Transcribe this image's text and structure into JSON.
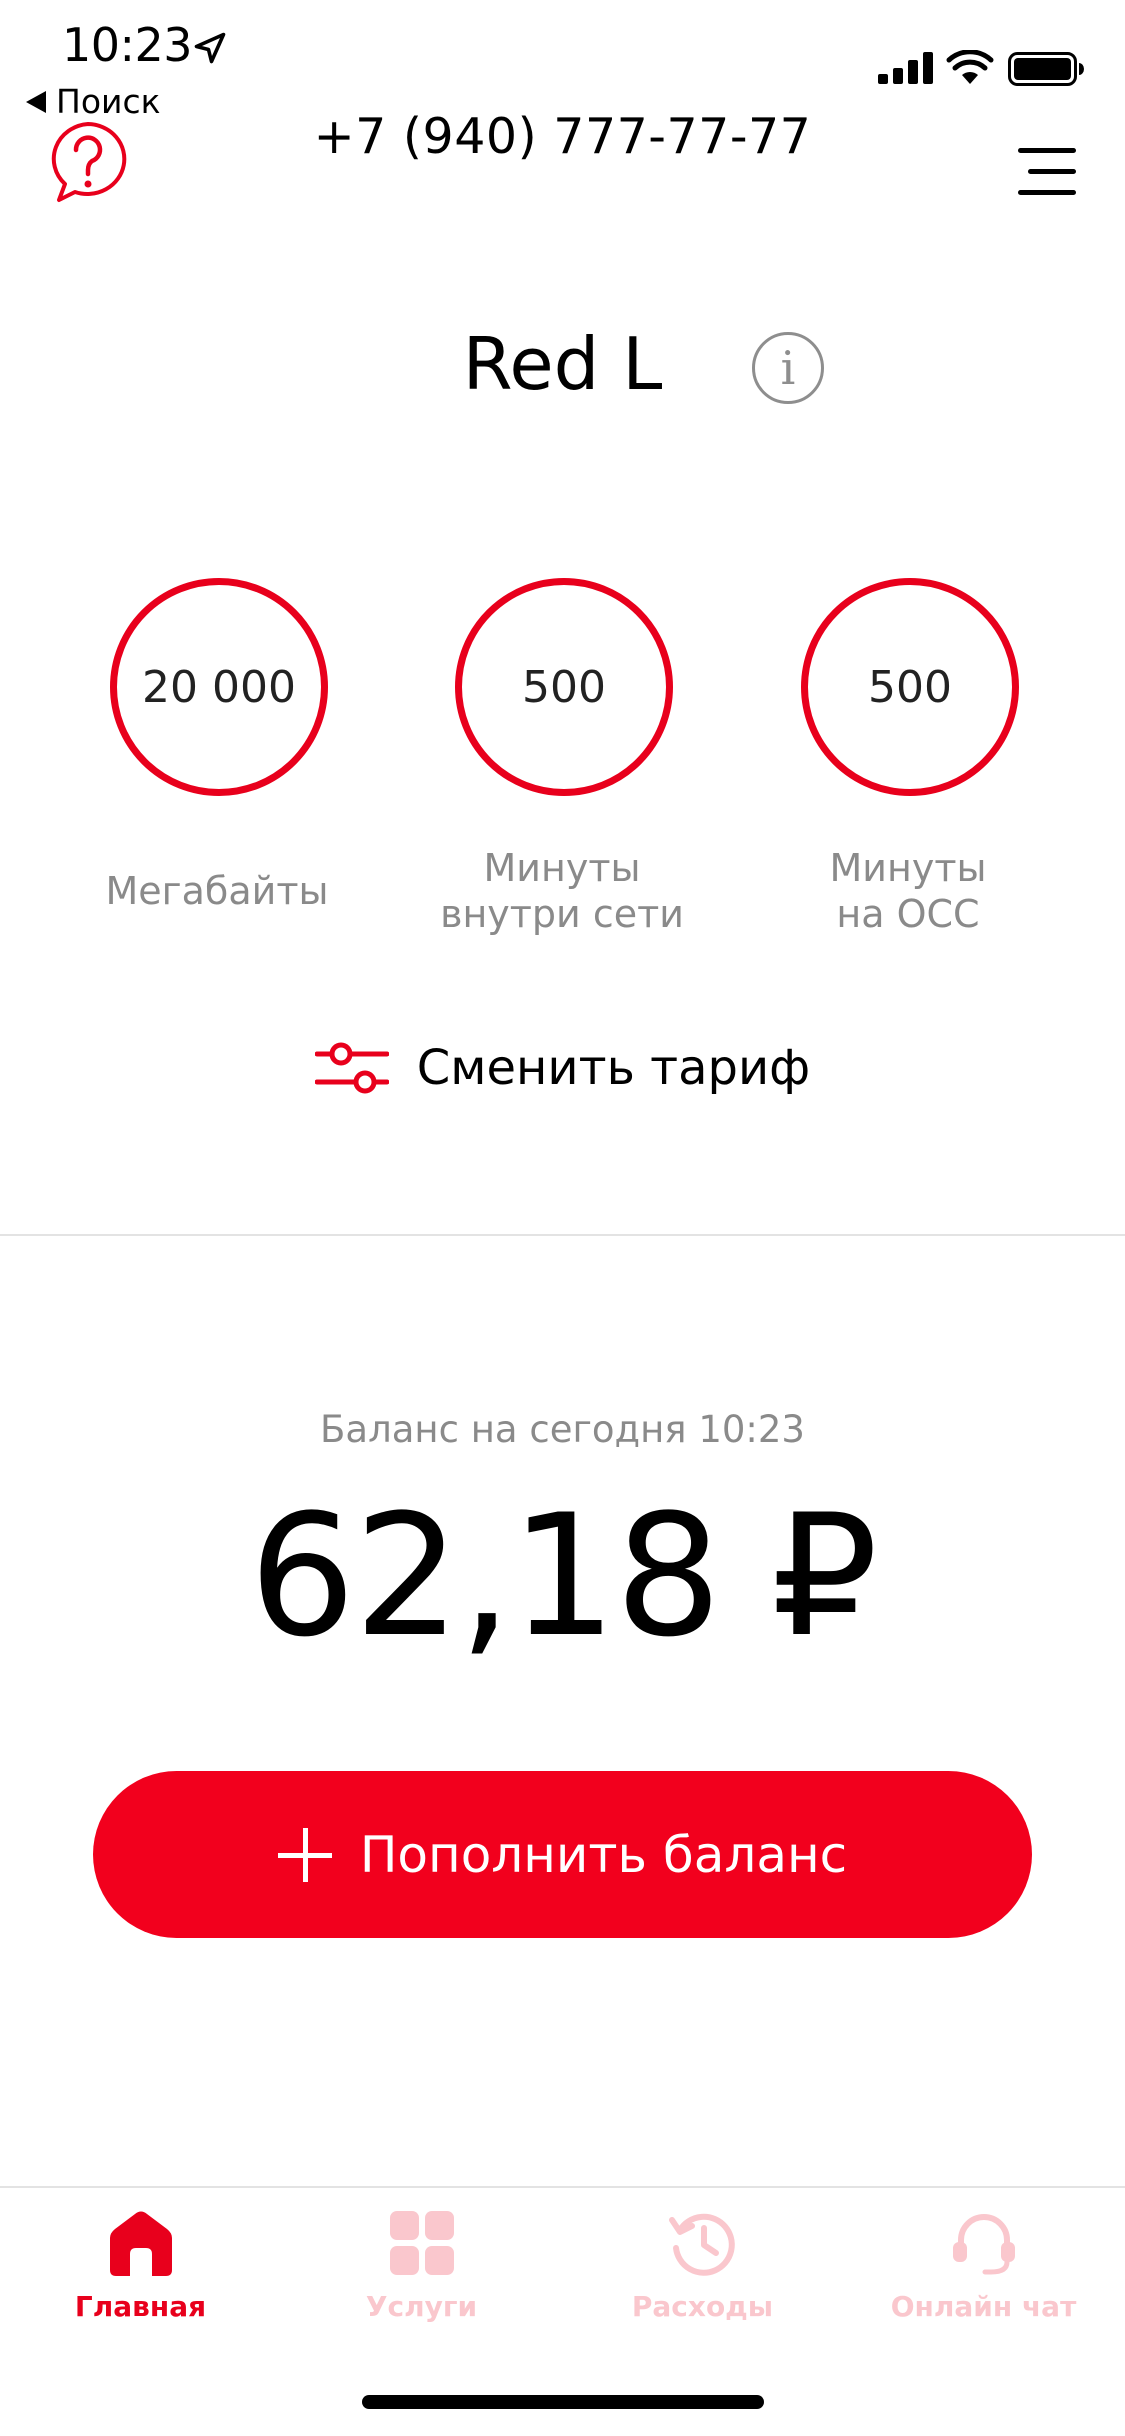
{
  "status_bar": {
    "time": "10:23",
    "back_label": "Поиск"
  },
  "header": {
    "phone": "+7 (940) 777-77-77",
    "help_icon": "question-bubble-icon",
    "menu_icon": "hamburger-menu-icon"
  },
  "tariff": {
    "name": "Red L",
    "info_glyph": "i",
    "counters": [
      {
        "value": "20 000",
        "label_line1": "Мегабайты",
        "label_line2": ""
      },
      {
        "value": "500",
        "label_line1": "Минуты",
        "label_line2": "внутри сети"
      },
      {
        "value": "500",
        "label_line1": "Минуты",
        "label_line2": "на ОСС"
      }
    ],
    "change_label": "Сменить тариф"
  },
  "balance": {
    "label": "Баланс на сегодня 10:23",
    "value": "62,18 ₽",
    "topup_label": "Пополнить баланс"
  },
  "tabs": [
    {
      "label": "Главная",
      "icon": "home-icon",
      "active": true
    },
    {
      "label": "Услуги",
      "icon": "grid-icon",
      "active": false
    },
    {
      "label": "Расходы",
      "icon": "history-icon",
      "active": false
    },
    {
      "label": "Онлайн чат",
      "icon": "headset-icon",
      "active": false
    }
  ],
  "colors": {
    "accent": "#e8001c",
    "button": "#f2001d",
    "inactive_tab": "#fac7cd",
    "muted_text": "#8a8a8a"
  }
}
